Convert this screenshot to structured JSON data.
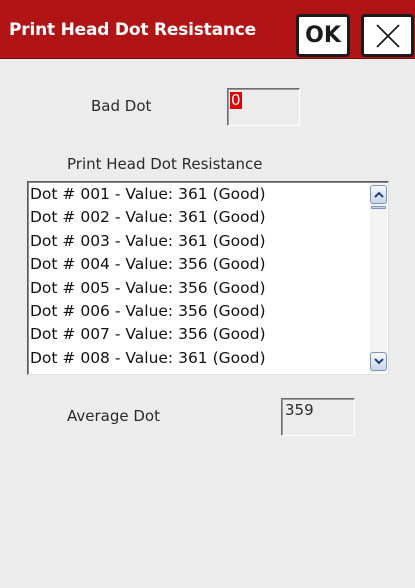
{
  "window": {
    "title": "Print Head Dot Resistance",
    "ok_label": "OK",
    "close_icon": "close-icon",
    "titlebar_color": "#b01414"
  },
  "bad_dot": {
    "label": "Bad Dot",
    "value": "0",
    "highlight_color": "#e00000"
  },
  "list": {
    "heading": "Print Head Dot Resistance",
    "items": [
      "Dot # 001 - Value: 361 (Good)",
      "Dot # 002 - Value: 361 (Good)",
      "Dot # 003 - Value: 361 (Good)",
      "Dot # 004 - Value: 356 (Good)",
      "Dot # 005 - Value: 356 (Good)",
      "Dot # 006 - Value: 356 (Good)",
      "Dot # 007 - Value: 356 (Good)",
      "Dot # 008 - Value: 361 (Good)"
    ],
    "scroll_up_icon": "chevron-up-icon",
    "scroll_down_icon": "chevron-down-icon"
  },
  "average": {
    "label": "Average Dot",
    "value": "359"
  }
}
